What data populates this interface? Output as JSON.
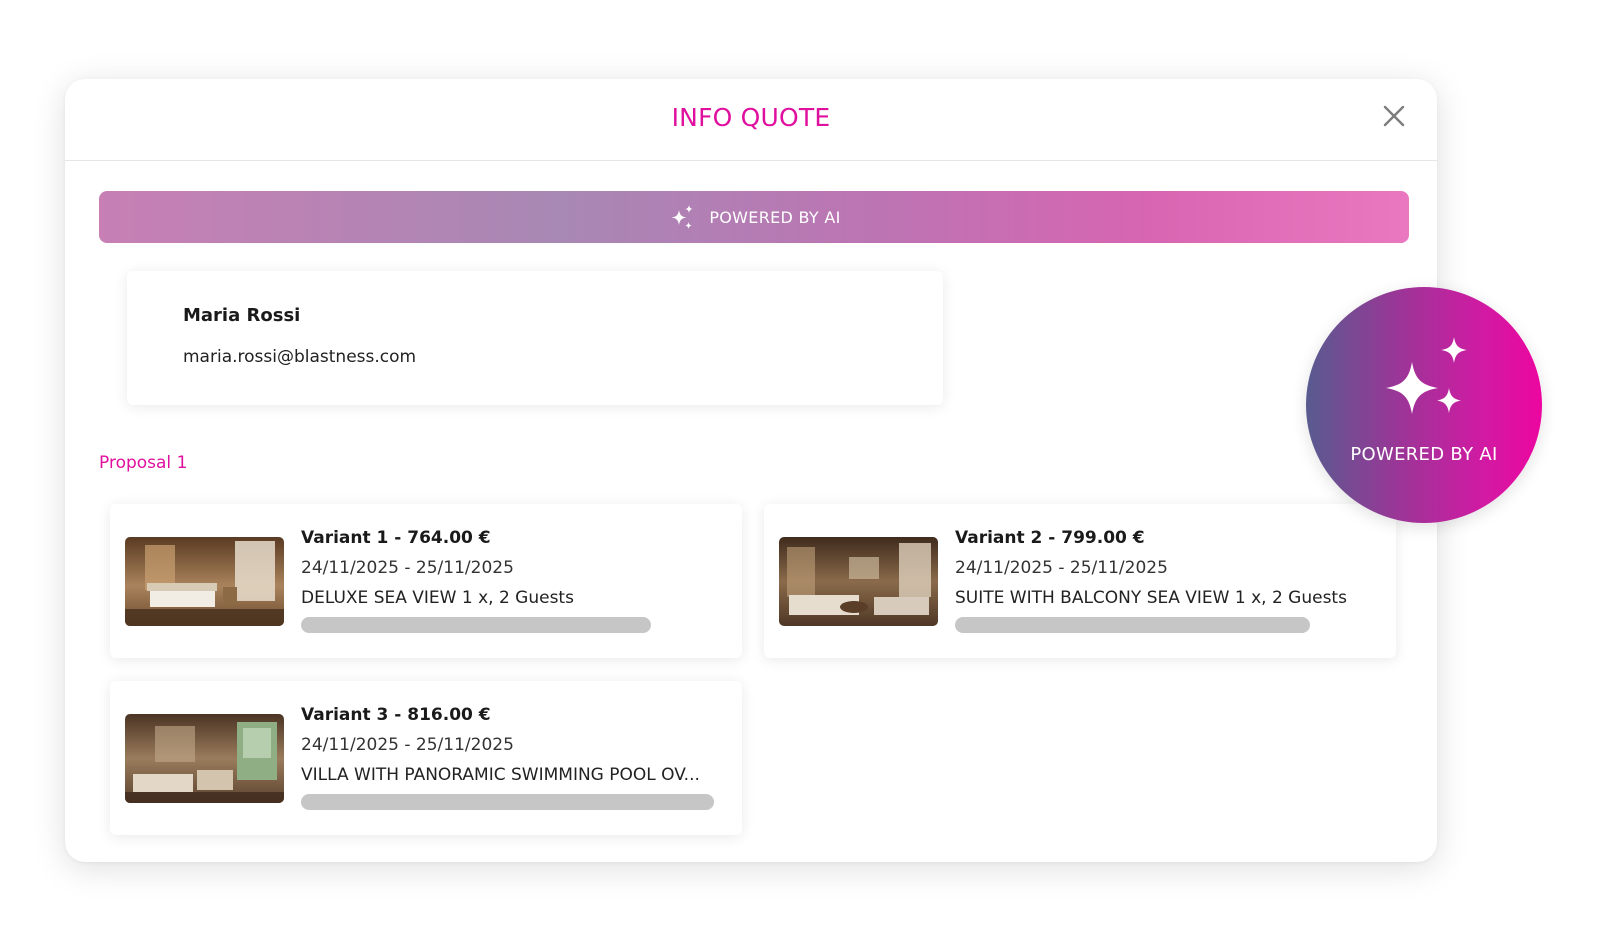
{
  "modal": {
    "title": "INFO QUOTE",
    "close_icon": "close-icon"
  },
  "ai_banner": {
    "label": "POWERED BY AI",
    "icon": "sparkles-icon"
  },
  "customer": {
    "name": "Maria Rossi",
    "email": "maria.rossi@blastness.com"
  },
  "proposal": {
    "label": "Proposal 1",
    "variants": [
      {
        "title": "Variant 1 - 764.00 €",
        "dates": "24/11/2025 - 25/11/2025",
        "room": "DELUXE SEA VIEW 1 x, 2 Guests",
        "image": "hotel-room-thumbnail"
      },
      {
        "title": "Variant 2 - 799.00 €",
        "dates": "24/11/2025 - 25/11/2025",
        "room": "SUITE WITH BALCONY SEA VIEW 1 x, 2 Guests",
        "image": "hotel-suite-thumbnail"
      },
      {
        "title": "Variant 3 - 816.00 €",
        "dates": "24/11/2025 - 25/11/2025",
        "room": "VILLA WITH PANORAMIC SWIMMING POOL OV...",
        "image": "hotel-villa-thumbnail"
      }
    ]
  },
  "ai_badge": {
    "label": "POWERED BY AI",
    "icon": "sparkles-icon"
  },
  "colors": {
    "accent": "#e0109e",
    "placeholder_bar": "#c6c6c6"
  }
}
